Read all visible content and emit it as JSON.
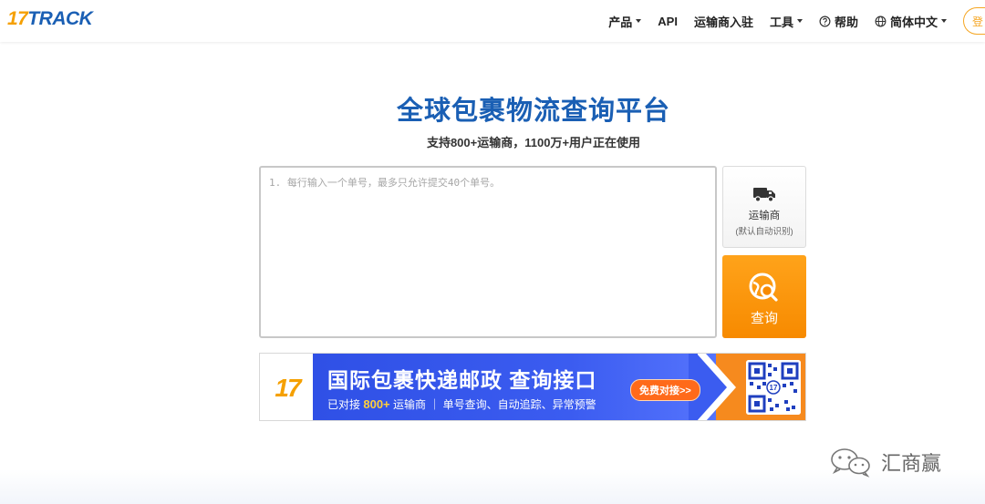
{
  "header": {
    "logo_num": "17",
    "logo_text": "TRACK",
    "nav": {
      "products": "产品",
      "api": "API",
      "carrier_join": "运输商入驻",
      "tools": "工具",
      "help": "帮助",
      "language": "简体中文",
      "login": "登"
    }
  },
  "hero": {
    "title": "全球包裹物流查询平台",
    "subtitle": "支持800+运输商，1100万+用户正在使用"
  },
  "tracking": {
    "placeholder": "1. 每行输入一个单号，最多只允许提交40个单号。",
    "carrier_label": "运输商",
    "carrier_sub": "(默认自动识别)",
    "query_label": "查询"
  },
  "banner": {
    "logo": "17",
    "headline": "国际包裹快递邮政 查询接口",
    "line2_prefix": "已对接",
    "line2_highlight": "800+",
    "line2_suffix": "运输商  ｜ 单号查询、自动追踪、异常预警",
    "cta": "免费对接>>",
    "colors": {
      "blue": "#3b5cf0",
      "orange": "#f68a1e"
    }
  },
  "watermark": {
    "text": "汇商赢",
    "icon": "wechat-icon"
  },
  "colors": {
    "brand_blue": "#1a5fb4",
    "brand_orange": "#f5a000",
    "query_orange": "#f78a00"
  }
}
